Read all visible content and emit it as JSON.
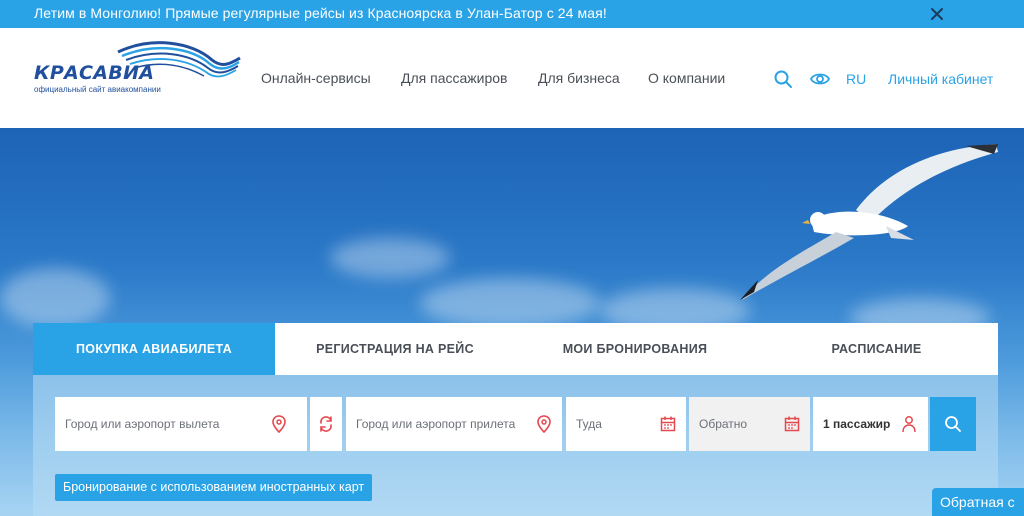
{
  "announcement": {
    "text": "Летим в Монголию! Прямые регулярные рейсы из Красноярска в Улан-Батор с 24 мая!"
  },
  "logo": {
    "name": "КРАСАВИА",
    "subtitle": "официальный сайт авиакомпании"
  },
  "nav": {
    "items": [
      "Онлайн-сервисы",
      "Для пассажиров",
      "Для бизнеса",
      "О компании"
    ]
  },
  "header_actions": {
    "language": "RU",
    "cabinet": "Личный кабинет"
  },
  "booking": {
    "tabs": [
      {
        "label": "ПОКУПКА АВИАБИЛЕТА",
        "active": true
      },
      {
        "label": "РЕГИСТРАЦИЯ НА РЕЙС",
        "active": false
      },
      {
        "label": "МОИ БРОНИРОВАНИЯ",
        "active": false
      },
      {
        "label": "РАСПИСАНИЕ",
        "active": false
      }
    ],
    "from_placeholder": "Город или аэропорт вылета",
    "to_placeholder": "Город или аэропорт прилета",
    "depart_placeholder": "Туда",
    "return_placeholder": "Обратно",
    "passengers": "1 пассажир",
    "foreign_cards": "Бронирование с использованием иностранных карт"
  },
  "feedback": {
    "label": "Обратная с"
  },
  "colors": {
    "accent": "#2aa3e6",
    "brand": "#1f4f9d",
    "icon_red": "#e5484d"
  },
  "icons": [
    "close-icon",
    "search-icon",
    "eye-icon",
    "location-pin-icon",
    "swap-icon",
    "calendar-icon",
    "person-icon"
  ]
}
